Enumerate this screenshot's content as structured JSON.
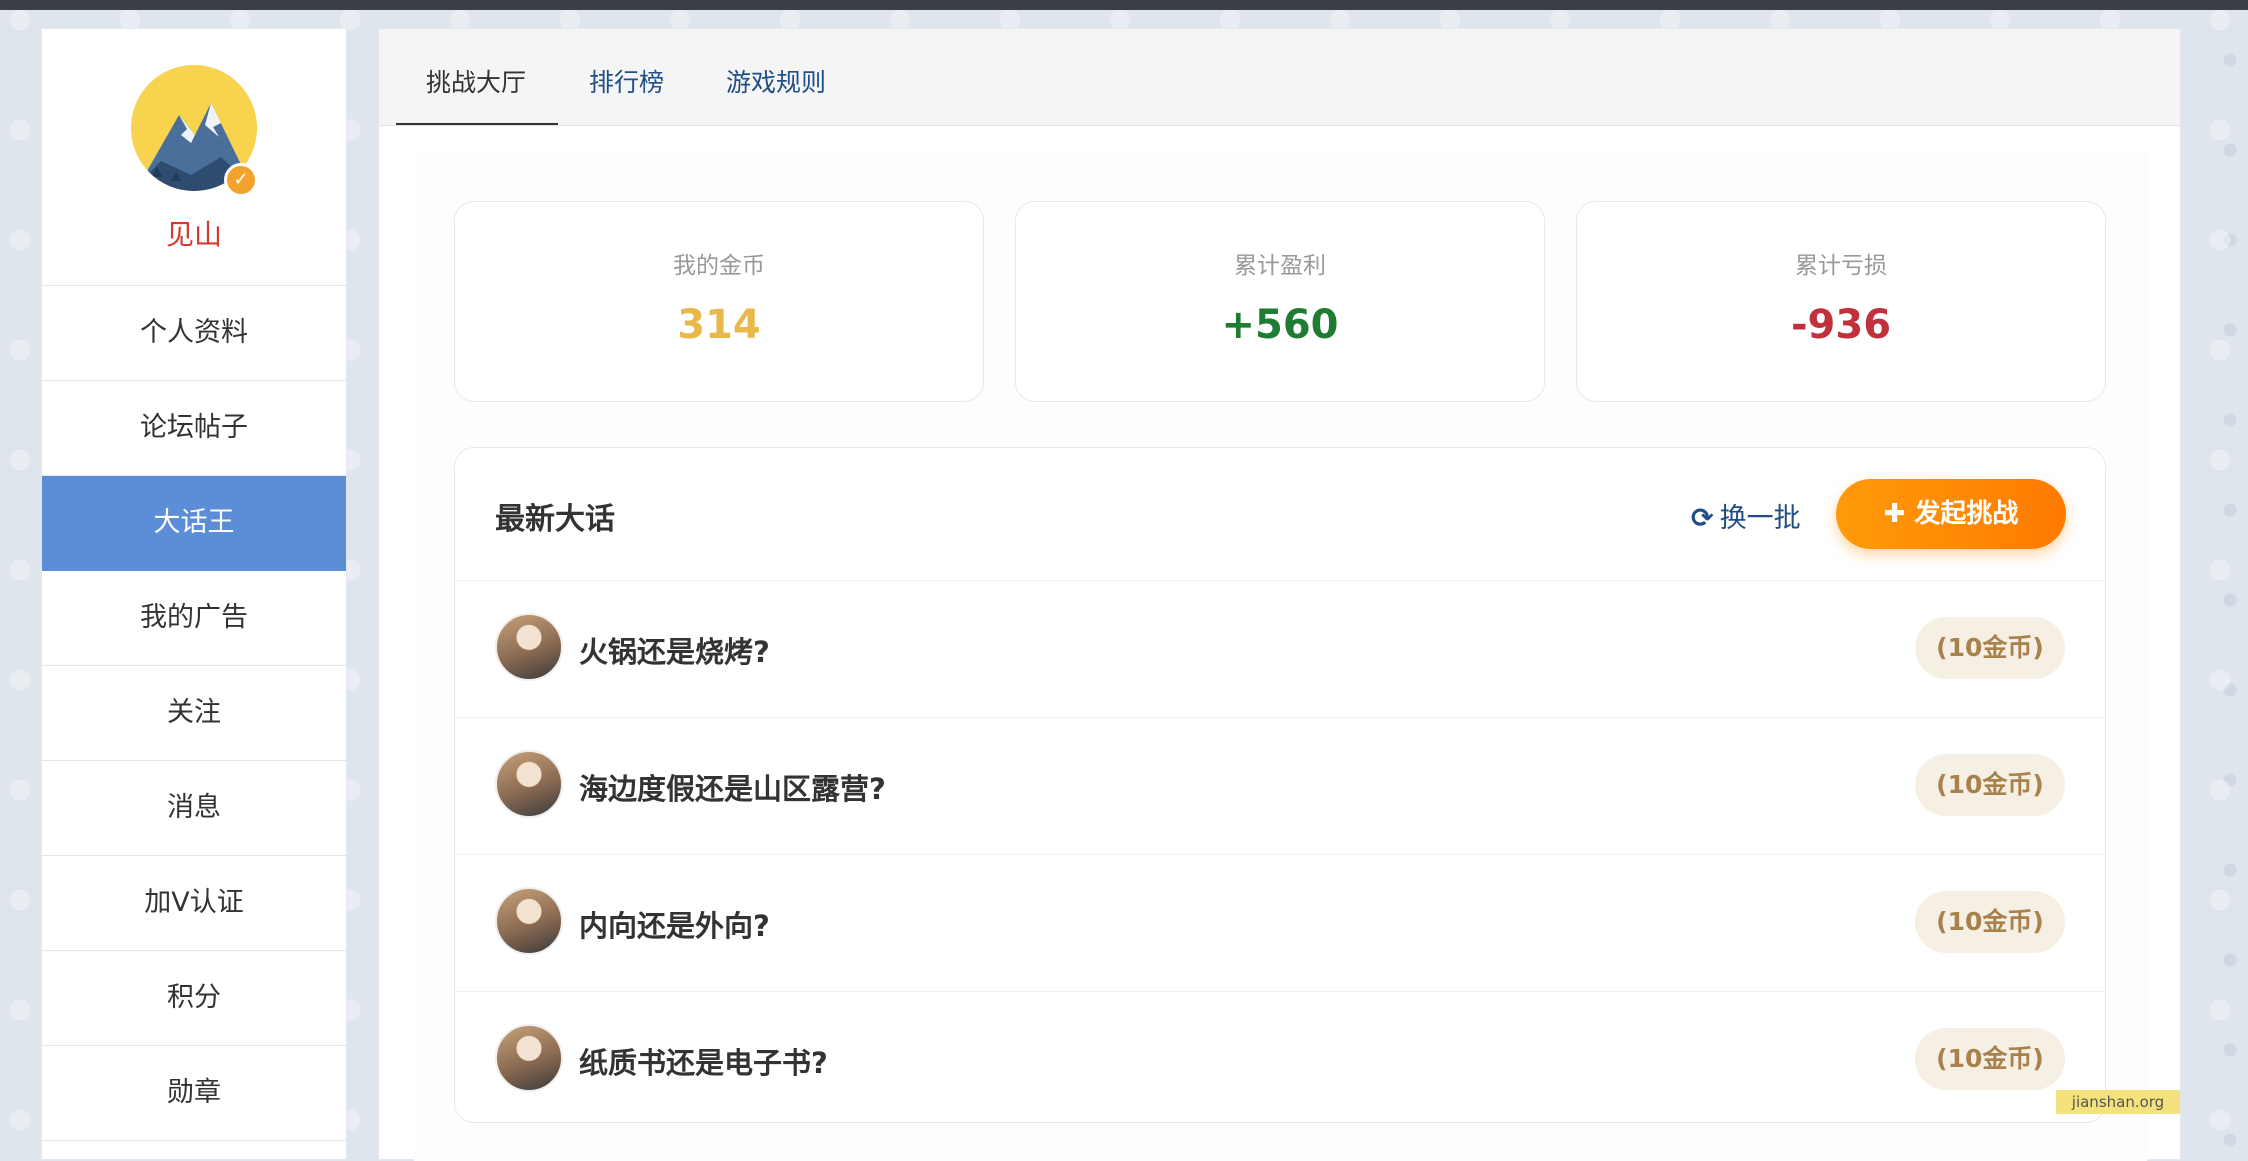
{
  "user": {
    "name": "见山"
  },
  "sidebar": {
    "items": [
      {
        "label": "个人资料"
      },
      {
        "label": "论坛帖子"
      },
      {
        "label": "大话王"
      },
      {
        "label": "我的广告"
      },
      {
        "label": "关注"
      },
      {
        "label": "消息"
      },
      {
        "label": "加V认证"
      },
      {
        "label": "积分"
      },
      {
        "label": "勋章"
      }
    ],
    "active_index": 2,
    "active_color": "#5b8ed6"
  },
  "tabs": [
    {
      "label": "挑战大厅"
    },
    {
      "label": "排行榜"
    },
    {
      "label": "游戏规则"
    }
  ],
  "stats": [
    {
      "label": "我的金币",
      "value": "314",
      "color": "#e8b84a"
    },
    {
      "label": "累计盈利",
      "value": "+560",
      "color": "#1e7d32"
    },
    {
      "label": "累计亏损",
      "value": "-936",
      "color": "#c0313c"
    }
  ],
  "list": {
    "title": "最新大话",
    "refresh_label": "换一批",
    "refresh_icon": "refresh-icon",
    "challenge_label": "发起挑战",
    "challenge_icon": "plus-icon",
    "rows": [
      {
        "text": "火锅还是烧烤?",
        "coins": "(10金币)"
      },
      {
        "text": "海边度假还是山区露营?",
        "coins": "(10金币)"
      },
      {
        "text": "内向还是外向?",
        "coins": "(10金币)"
      },
      {
        "text": "纸质书还是电子书?",
        "coins": "(10金币)"
      }
    ]
  },
  "watermark": "jianshan.org",
  "verified_icon": "verified-badge-icon"
}
